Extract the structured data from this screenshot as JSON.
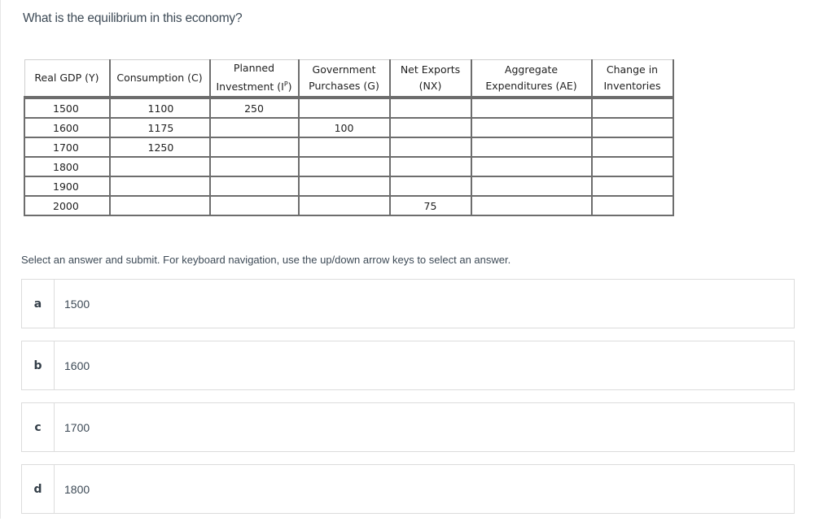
{
  "question": {
    "title": "What is the equilibrium in this economy?"
  },
  "table": {
    "headers": [
      {
        "line1": "Real GDP (Y)",
        "line2": ""
      },
      {
        "line1": "Consumption (C)",
        "line2": ""
      },
      {
        "line1": "Planned",
        "line2": "Investment (I",
        "sup": "P",
        "suffix": ")"
      },
      {
        "line1": "Government",
        "line2": "Purchases (G)"
      },
      {
        "line1": "Net Exports",
        "line2": "(NX)"
      },
      {
        "line1": "Aggregate",
        "line2": "Expenditures (AE)"
      },
      {
        "line1": "Change in",
        "line2": "Inventories"
      }
    ],
    "rows": [
      [
        "1500",
        "1100",
        "250",
        "",
        "",
        "",
        ""
      ],
      [
        "1600",
        "1175",
        "",
        "100",
        "",
        "",
        ""
      ],
      [
        "1700",
        "1250",
        "",
        "",
        "",
        "",
        ""
      ],
      [
        "1800",
        "",
        "",
        "",
        "",
        "",
        ""
      ],
      [
        "1900",
        "",
        "",
        "",
        "",
        "",
        ""
      ],
      [
        "2000",
        "",
        "",
        "",
        "75",
        "",
        ""
      ]
    ]
  },
  "instructions": "Select an answer and submit. For keyboard navigation, use the up/down arrow keys to select an answer.",
  "options": [
    {
      "letter": "a",
      "text": "1500"
    },
    {
      "letter": "b",
      "text": "1600"
    },
    {
      "letter": "c",
      "text": "1700"
    },
    {
      "letter": "d",
      "text": "1800"
    }
  ]
}
